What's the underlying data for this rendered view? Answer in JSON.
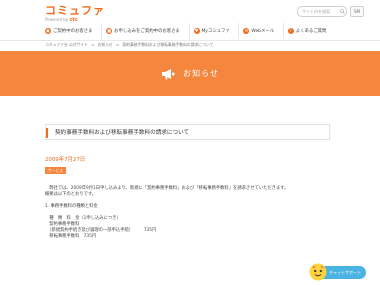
{
  "header": {
    "logo_main": "コミュファ",
    "logo_sub_prefix": "Powered by",
    "logo_sub_brand": "ctc",
    "search_placeholder": "サイト内を検索",
    "site_map_label": "SM"
  },
  "nav": {
    "items": [
      {
        "label": "ご契約中のお客さま",
        "icon": "user-icon"
      },
      {
        "label": "お申し込みをご契約中のお客さま",
        "icon": "document-icon"
      },
      {
        "label": "Myコミュファ",
        "icon": "heart-icon"
      },
      {
        "label": "Webメール",
        "icon": "mail-icon"
      },
      {
        "label": "よくあるご質問",
        "icon": "question-icon"
      }
    ]
  },
  "breadcrumb": {
    "items": [
      "コミュファ光 公式サイト",
      ">",
      "お知らせ",
      ">",
      "契約事務手数料および移転事務手数料の請求について"
    ]
  },
  "banner": {
    "title": "お知らせ",
    "icon": "megaphone-icon",
    "color": "#f5863d"
  },
  "article": {
    "title": "契約事務手数料および移転事務手数料の請求について",
    "date": "2009年7月27日",
    "category": "サービス",
    "lines": [
      "　弊社では、2009年9月1日申し込みより、新規に「契約事務手数料」および「移転事務手数料」を請求させていただきます。",
      "概要は以下のとおりです。",
      "",
      "1. 事務手数料の種類と料金",
      "",
      "　種　類　料　金（1申し込みにつき）",
      "　契約事務手数料",
      "　（新規契約手続き及び論理の一部申込手続）　　　735円",
      "　移転事務手数料　735円"
    ]
  },
  "chat": {
    "label": "チャットサポート",
    "icon": "chat-avatar-icon",
    "color": "#4bb3e2"
  },
  "colors": {
    "accent": "#f26b1d",
    "banner": "#f5863d"
  }
}
